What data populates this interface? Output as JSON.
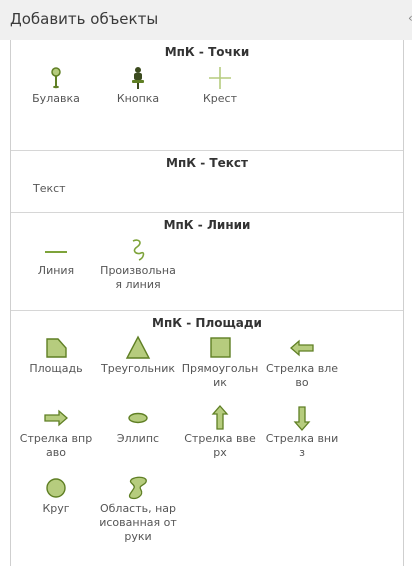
{
  "header": {
    "title": "Добавить объекты"
  },
  "colors": {
    "fill": "#b6cc7e",
    "stroke": "#5f7f24",
    "dark": "#3b4a1e"
  },
  "sections": {
    "points": {
      "title": "МпК - Точки",
      "items": [
        {
          "label": "Булавка",
          "icon": "pin-icon"
        },
        {
          "label": "Кнопка",
          "icon": "pushpin-icon"
        },
        {
          "label": "Крест",
          "icon": "cross-icon"
        }
      ]
    },
    "text": {
      "title": "МпК - Текст",
      "items": [
        {
          "label": "Текст"
        }
      ]
    },
    "lines": {
      "title": "МпК - Линии",
      "items": [
        {
          "label": "Линия",
          "icon": "line-icon"
        },
        {
          "label": "Произвольная линия",
          "icon": "freehand-line-icon"
        }
      ]
    },
    "areas": {
      "title": "МпК - Площади",
      "items": [
        {
          "label": "Площадь",
          "icon": "area-icon"
        },
        {
          "label": "Треугольник",
          "icon": "triangle-icon"
        },
        {
          "label": "Прямоугольник",
          "icon": "rectangle-icon"
        },
        {
          "label": "Стрелка влево",
          "icon": "arrow-left-icon"
        },
        {
          "label": "Стрелка вправо",
          "icon": "arrow-right-icon"
        },
        {
          "label": "Эллипс",
          "icon": "ellipse-icon"
        },
        {
          "label": "Стрелка вверх",
          "icon": "arrow-up-icon"
        },
        {
          "label": "Стрелка вниз",
          "icon": "arrow-down-icon"
        },
        {
          "label": "Круг",
          "icon": "circle-icon"
        },
        {
          "label": "Область, нарисованная от руки",
          "icon": "freehand-area-icon"
        }
      ]
    }
  }
}
